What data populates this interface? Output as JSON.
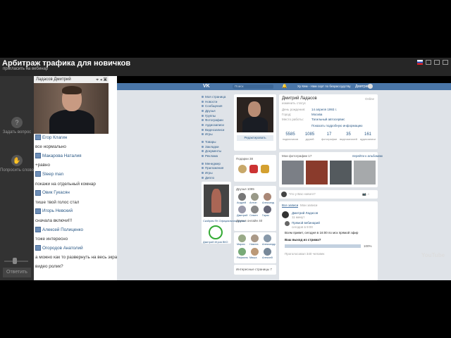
{
  "topbar": {
    "title": "Арбитраж трафика для новичков",
    "subtitle": "пригласить на вебинар"
  },
  "leftbar": {
    "ask_label": "Задать вопрос",
    "raise_label": "Попросить слово",
    "reply_label": "Ответить",
    "slider_level": 0.5
  },
  "video": {
    "presenter_name": "Ладасов Дмитрий"
  },
  "chat": {
    "messages": [
      {
        "type": "name",
        "text": "Егор Клагин"
      },
      {
        "type": "text",
        "text": "все нормально"
      },
      {
        "type": "name",
        "text": "Макарова Наталия"
      },
      {
        "type": "text",
        "text": "+равно"
      },
      {
        "type": "name",
        "text": "Sleep man"
      },
      {
        "type": "text",
        "text": "покажи на отдельный комнар"
      },
      {
        "type": "name",
        "text": "Овик Гукасян"
      },
      {
        "type": "text",
        "text": "тише твой голос стал"
      },
      {
        "type": "name",
        "text": "Игорь Невский"
      },
      {
        "type": "text",
        "text": "сначала включи!!!"
      },
      {
        "type": "name",
        "text": "Алексей Полиценко"
      },
      {
        "type": "text",
        "text": "тоже интересно"
      },
      {
        "type": "name",
        "text": "Огородов Анатолий"
      },
      {
        "type": "text",
        "text": "а можно как то развернуть на весь экран"
      },
      {
        "type": "text",
        "text": "видео ролик?"
      }
    ]
  },
  "vk": {
    "logo": "VK",
    "search_placeholder": "Поиск",
    "music": "Ху Кем - Нам сорт по безрассудству",
    "user": "Дмитрий",
    "nav": [
      "Моя страница",
      "Новости",
      "Сообщения",
      "Друзья",
      "Группы",
      "Фотографии",
      "Аудиозаписи",
      "Видеозаписи",
      "Игры",
      "Товары",
      "Закладки",
      "Документы",
      "Реклама",
      "Менеджер",
      "Приложения",
      "Игры",
      "Дипло"
    ],
    "profile": {
      "name": "Дмитрий Ладасов",
      "status": "изменить статус",
      "edit_link": "Online",
      "fields": [
        {
          "label": "День рождения:",
          "value": "14 апреля 1993 г."
        },
        {
          "label": "Город:",
          "value": "Москва"
        },
        {
          "label": "Место работы:",
          "value": "Тагильный автосервис"
        }
      ],
      "show_more": "Показать подробную информацию",
      "edit_button": "Редактировать"
    },
    "stats": [
      {
        "num": "5585",
        "label": "подписчиков"
      },
      {
        "num": "1085",
        "label": "друзей"
      },
      {
        "num": "17",
        "label": "фотографии"
      },
      {
        "num": "35",
        "label": "видеозаписей"
      },
      {
        "num": "161",
        "label": "аудиозаписи"
      }
    ],
    "gifts_title": "Подарки 38",
    "photos_title": "Мои фотографии 17",
    "photos_action": "перейти к альбомам",
    "friends_title": "Друзья 1085",
    "friends_online_title": "Друзья онлайн 40",
    "friends_names_1": [
      "Андрей",
      "Антон",
      "Александ"
    ],
    "friends_names_2": [
      "Дмитрий",
      "Семен",
      "Гарик"
    ],
    "friends_names_3": [
      "Мария",
      "Никита",
      "Александр"
    ],
    "friends_names_4": [
      "Рафаэль",
      "Миша",
      "Алексей"
    ],
    "post_placeholder": "Что у Вас нового?",
    "wall_tabs": [
      "Все записи",
      "Мои записи"
    ],
    "post_author": "Дмитрий Ладасов",
    "post_time": "11 минут",
    "repost_from": "Прямой вебинарий",
    "repost_time": "сегодня в 9:00",
    "post_text": "Всем привет, сегодня в 16:00 по мск прямой эфир",
    "poll_title": "Ваш выход из стрима?",
    "poll_pct": "100%",
    "poll_level": 1.0,
    "poll_count": "Проголосовал 340 человек",
    "audio_title": "Интересные страницы 7",
    "game_caption": "Скайрим ПК Официальная группа",
    "sub_caption": "Дмитрий Игров ВКО",
    "watermark": "YouTube"
  },
  "colors": {
    "vk_blue": "#4a76a8",
    "link": "#2a5885",
    "chat_bg": "#ffffff",
    "dark_panel": "#2b2b2b"
  }
}
